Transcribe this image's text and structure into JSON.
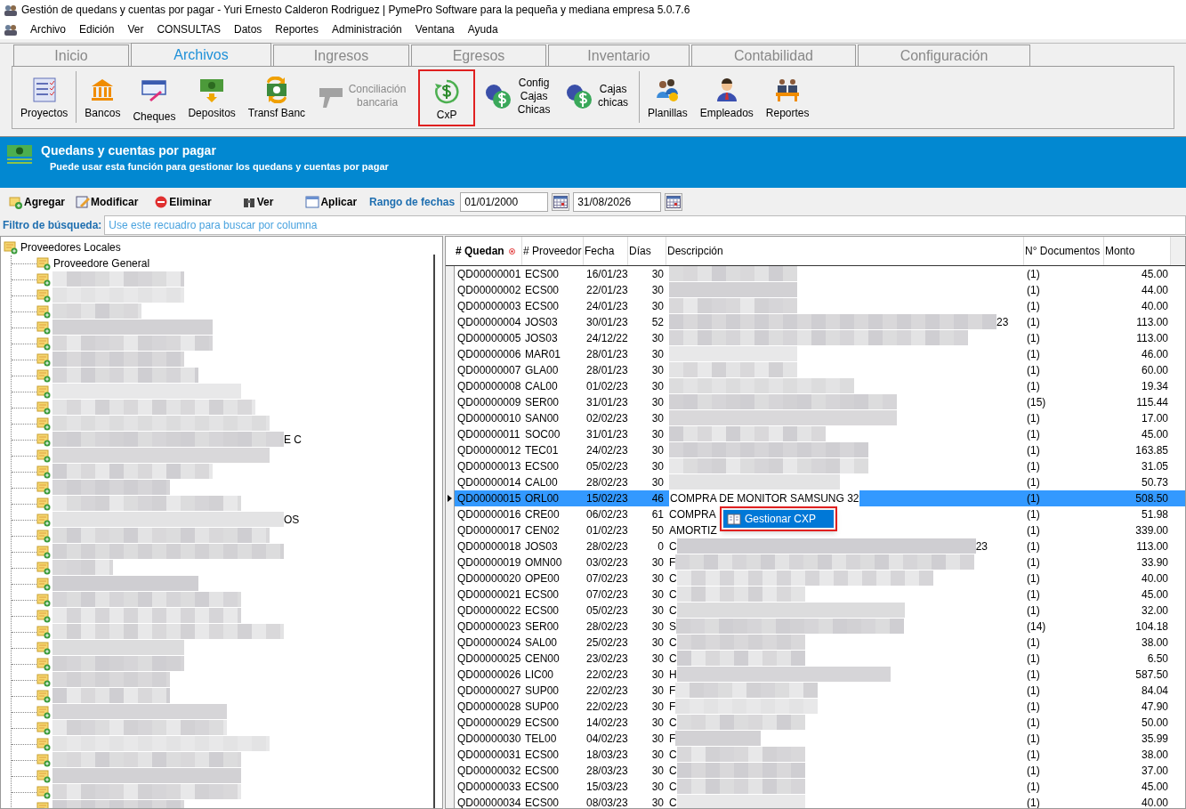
{
  "window": {
    "title": "Gestión de quedans y cuentas por pagar - Yuri Ernesto Calderon Rodriguez | PymePro Software para la pequeña y mediana empresa 5.0.7.6"
  },
  "menu": [
    "Archivo",
    "Edición",
    "Ver",
    "CONSULTAS",
    "Datos",
    "Reportes",
    "Administración",
    "Ventana",
    "Ayuda"
  ],
  "tabs": [
    {
      "label": "Inicio",
      "selected": false
    },
    {
      "label": "Archivos",
      "selected": true
    },
    {
      "label": "Ingresos",
      "selected": false
    },
    {
      "label": "Egresos",
      "selected": false
    },
    {
      "label": "Inventario",
      "selected": false
    },
    {
      "label": "Contabilidad",
      "selected": false
    },
    {
      "label": "Configuración",
      "selected": false
    }
  ],
  "ribbon": [
    {
      "label": "Proyectos",
      "kind": "projects",
      "disabled": false,
      "highlighted": false,
      "separator_after": true
    },
    {
      "label": "Bancos",
      "kind": "bank",
      "disabled": false,
      "highlighted": false,
      "separator_after": false
    },
    {
      "label": "Cheques",
      "kind": "cheque",
      "disabled": false,
      "highlighted": false,
      "separator_after": false
    },
    {
      "label": "Depositos",
      "kind": "deposit",
      "disabled": false,
      "highlighted": false,
      "separator_after": false
    },
    {
      "label": "Transf Banc",
      "kind": "transfer",
      "disabled": false,
      "highlighted": false,
      "separator_after": false
    },
    {
      "label": "Conciliación bancaria",
      "kind": "reconcile",
      "disabled": true,
      "highlighted": false,
      "separator_after": false
    },
    {
      "label": "CxP",
      "kind": "cxp",
      "disabled": false,
      "highlighted": true,
      "separator_after": false
    },
    {
      "label": "Config Cajas Chicas",
      "kind": "coins",
      "disabled": false,
      "highlighted": false,
      "separator_after": false
    },
    {
      "label": "Cajas chicas",
      "kind": "coins",
      "disabled": false,
      "highlighted": false,
      "separator_after": true
    },
    {
      "label": "Planillas",
      "kind": "payroll",
      "disabled": false,
      "highlighted": false,
      "separator_after": false
    },
    {
      "label": "Empleados",
      "kind": "employee",
      "disabled": false,
      "highlighted": false,
      "separator_after": false
    },
    {
      "label": "Reportes",
      "kind": "reports",
      "disabled": false,
      "highlighted": false,
      "separator_after": false
    }
  ],
  "banner": {
    "title": "Quedans y cuentas por pagar",
    "subtitle": "Puede usar esta función para gestionar los quedans y cuentas por pagar"
  },
  "toolbar": [
    {
      "label": "Agregar",
      "kind": "add"
    },
    {
      "label": "Modificar",
      "kind": "edit"
    },
    {
      "label": "Eliminar",
      "kind": "delete"
    },
    {
      "label": "Ver",
      "kind": "view"
    },
    {
      "label": "Aplicar",
      "kind": "apply"
    }
  ],
  "date_range": {
    "label": "Rango de fechas",
    "from": "01/01/2000",
    "to": "31/08/2026"
  },
  "filter": {
    "label": "Filtro de búsqueda:",
    "placeholder": "Use este recuadro para buscar por columna"
  },
  "tree": {
    "label": "Proveedores Locales",
    "expanded": true,
    "children": [
      {
        "kind": "named",
        "label": "Proveedore General"
      },
      {
        "kind": "redacted"
      },
      {
        "kind": "redacted"
      },
      {
        "kind": "redacted"
      },
      {
        "kind": "redacted"
      },
      {
        "kind": "redacted"
      },
      {
        "kind": "redacted"
      },
      {
        "kind": "redacted"
      },
      {
        "kind": "redacted"
      },
      {
        "kind": "redacted"
      },
      {
        "kind": "redacted"
      },
      {
        "kind": "redacted",
        "label_end": "E C"
      },
      {
        "kind": "redacted"
      },
      {
        "kind": "redacted"
      },
      {
        "kind": "redacted"
      },
      {
        "kind": "redacted"
      },
      {
        "kind": "redacted",
        "label_end": "OS"
      },
      {
        "kind": "redacted"
      },
      {
        "kind": "redacted"
      },
      {
        "kind": "redacted"
      },
      {
        "kind": "redacted"
      },
      {
        "kind": "redacted"
      },
      {
        "kind": "redacted"
      },
      {
        "kind": "redacted"
      },
      {
        "kind": "redacted"
      },
      {
        "kind": "redacted"
      },
      {
        "kind": "redacted"
      },
      {
        "kind": "redacted"
      },
      {
        "kind": "redacted"
      },
      {
        "kind": "redacted"
      },
      {
        "kind": "redacted"
      },
      {
        "kind": "redacted"
      },
      {
        "kind": "redacted"
      },
      {
        "kind": "redacted"
      },
      {
        "kind": "redacted"
      }
    ]
  },
  "table": {
    "columns": [
      {
        "label": "# Quedan",
        "sorted": true
      },
      {
        "label": "# Proveedor",
        "sorted": false
      },
      {
        "label": "Fecha",
        "sorted": false
      },
      {
        "label": "Días",
        "sorted": false
      },
      {
        "label": "Descripción",
        "sorted": false
      },
      {
        "label": "N° Documentos",
        "sorted": false
      },
      {
        "label": "Monto",
        "sorted": false
      }
    ],
    "rows": [
      {
        "quedan": "QD00000001",
        "proveedor": "ECS00",
        "fecha": "16/01/23",
        "dias": "30",
        "documentos": "(1)",
        "monto": "45.00",
        "selected": false
      },
      {
        "quedan": "QD00000002",
        "proveedor": "ECS00",
        "fecha": "22/01/23",
        "dias": "30",
        "documentos": "(1)",
        "monto": "44.00",
        "selected": false
      },
      {
        "quedan": "QD00000003",
        "proveedor": "ECS00",
        "fecha": "24/01/23",
        "dias": "30",
        "documentos": "(1)",
        "monto": "40.00",
        "selected": false
      },
      {
        "quedan": "QD00000004",
        "proveedor": "JOS03",
        "fecha": "30/01/23",
        "dias": "52",
        "description_end": "23",
        "documentos": "(1)",
        "monto": "113.00",
        "selected": false
      },
      {
        "quedan": "QD00000005",
        "proveedor": "JOS03",
        "fecha": "24/12/22",
        "dias": "30",
        "documentos": "(1)",
        "monto": "113.00",
        "selected": false
      },
      {
        "quedan": "QD00000006",
        "proveedor": "MAR01",
        "fecha": "28/01/23",
        "dias": "30",
        "documentos": "(1)",
        "monto": "46.00",
        "selected": false
      },
      {
        "quedan": "QD00000007",
        "proveedor": "GLA00",
        "fecha": "28/01/23",
        "dias": "30",
        "documentos": "(1)",
        "monto": "60.00",
        "selected": false
      },
      {
        "quedan": "QD00000008",
        "proveedor": "CAL00",
        "fecha": "01/02/23",
        "dias": "30",
        "documentos": "(1)",
        "monto": "19.34",
        "selected": false
      },
      {
        "quedan": "QD00000009",
        "proveedor": "SER00",
        "fecha": "31/01/23",
        "dias": "30",
        "documentos": "(15)",
        "monto": "115.44",
        "selected": false
      },
      {
        "quedan": "QD00000010",
        "proveedor": "SAN00",
        "fecha": "02/02/23",
        "dias": "30",
        "documentos": "(1)",
        "monto": "17.00",
        "selected": false
      },
      {
        "quedan": "QD00000011",
        "proveedor": "SOC00",
        "fecha": "31/01/23",
        "dias": "30",
        "documentos": "(1)",
        "monto": "45.00",
        "selected": false
      },
      {
        "quedan": "QD00000012",
        "proveedor": "TEC01",
        "fecha": "24/02/23",
        "dias": "30",
        "documentos": "(1)",
        "monto": "163.85",
        "selected": false
      },
      {
        "quedan": "QD00000013",
        "proveedor": "ECS00",
        "fecha": "05/02/23",
        "dias": "30",
        "documentos": "(1)",
        "monto": "31.05",
        "selected": false
      },
      {
        "quedan": "QD00000014",
        "proveedor": "CAL00",
        "fecha": "28/02/23",
        "dias": "30",
        "documentos": "(1)",
        "monto": "50.73",
        "selected": false
      },
      {
        "quedan": "QD00000015",
        "proveedor": "ORL00",
        "fecha": "15/02/23",
        "dias": "46",
        "descripcion": "COMPRA DE MONITOR SAMSUNG 32",
        "documentos": "(1)",
        "monto": "508.50",
        "selected": true
      },
      {
        "quedan": "QD00000016",
        "proveedor": "CRE00",
        "fecha": "06/02/23",
        "dias": "61",
        "descripcion": "COMPRA",
        "documentos": "(1)",
        "monto": "51.98",
        "selected": false
      },
      {
        "quedan": "QD00000017",
        "proveedor": "CEN02",
        "fecha": "01/02/23",
        "dias": "50",
        "descripcion": "AMORTIZ",
        "documentos": "(1)",
        "monto": "339.00",
        "selected": false
      },
      {
        "quedan": "QD00000018",
        "proveedor": "JOS03",
        "fecha": "28/02/23",
        "dias": "0",
        "descripcion": "C",
        "description_end": "23",
        "documentos": "(1)",
        "monto": "113.00",
        "selected": false
      },
      {
        "quedan": "QD00000019",
        "proveedor": "OMN00",
        "fecha": "03/02/23",
        "dias": "30",
        "descripcion": "F",
        "documentos": "(1)",
        "monto": "33.90",
        "selected": false
      },
      {
        "quedan": "QD00000020",
        "proveedor": "OPE00",
        "fecha": "07/02/23",
        "dias": "30",
        "descripcion": "C",
        "documentos": "(1)",
        "monto": "40.00",
        "selected": false
      },
      {
        "quedan": "QD00000021",
        "proveedor": "ECS00",
        "fecha": "07/02/23",
        "dias": "30",
        "descripcion": "C",
        "documentos": "(1)",
        "monto": "45.00",
        "selected": false
      },
      {
        "quedan": "QD00000022",
        "proveedor": "ECS00",
        "fecha": "05/02/23",
        "dias": "30",
        "descripcion": "C",
        "documentos": "(1)",
        "monto": "32.00",
        "selected": false
      },
      {
        "quedan": "QD00000023",
        "proveedor": "SER00",
        "fecha": "28/02/23",
        "dias": "30",
        "descripcion": "S",
        "documentos": "(14)",
        "monto": "104.18",
        "selected": false
      },
      {
        "quedan": "QD00000024",
        "proveedor": "SAL00",
        "fecha": "25/02/23",
        "dias": "30",
        "descripcion": "C",
        "documentos": "(1)",
        "monto": "38.00",
        "selected": false
      },
      {
        "quedan": "QD00000025",
        "proveedor": "CEN00",
        "fecha": "23/02/23",
        "dias": "30",
        "descripcion": "C",
        "documentos": "(1)",
        "monto": "6.50",
        "selected": false
      },
      {
        "quedan": "QD00000026",
        "proveedor": "LIC00",
        "fecha": "22/02/23",
        "dias": "30",
        "descripcion": "H",
        "documentos": "(1)",
        "monto": "587.50",
        "selected": false
      },
      {
        "quedan": "QD00000027",
        "proveedor": "SUP00",
        "fecha": "22/02/23",
        "dias": "30",
        "descripcion": "F",
        "documentos": "(1)",
        "monto": "84.04",
        "selected": false
      },
      {
        "quedan": "QD00000028",
        "proveedor": "SUP00",
        "fecha": "22/02/23",
        "dias": "30",
        "descripcion": "F",
        "documentos": "(1)",
        "monto": "47.90",
        "selected": false
      },
      {
        "quedan": "QD00000029",
        "proveedor": "ECS00",
        "fecha": "14/02/23",
        "dias": "30",
        "descripcion": "C",
        "documentos": "(1)",
        "monto": "50.00",
        "selected": false
      },
      {
        "quedan": "QD00000030",
        "proveedor": "TEL00",
        "fecha": "04/02/23",
        "dias": "30",
        "descripcion": "F",
        "documentos": "(1)",
        "monto": "35.99",
        "selected": false
      },
      {
        "quedan": "QD00000031",
        "proveedor": "ECS00",
        "fecha": "18/03/23",
        "dias": "30",
        "descripcion": "C",
        "documentos": "(1)",
        "monto": "38.00",
        "selected": false
      },
      {
        "quedan": "QD00000032",
        "proveedor": "ECS00",
        "fecha": "28/03/23",
        "dias": "30",
        "descripcion": "C",
        "documentos": "(1)",
        "monto": "37.00",
        "selected": false
      },
      {
        "quedan": "QD00000033",
        "proveedor": "ECS00",
        "fecha": "15/03/23",
        "dias": "30",
        "descripcion": "C",
        "documentos": "(1)",
        "monto": "45.00",
        "selected": false
      },
      {
        "quedan": "QD00000034",
        "proveedor": "ECS00",
        "fecha": "08/03/23",
        "dias": "30",
        "descripcion": "C",
        "documentos": "(1)",
        "monto": "40.00",
        "selected": false
      }
    ]
  },
  "context_menu": {
    "items": [
      {
        "label": "Gestionar CXP",
        "selected": true
      }
    ]
  }
}
